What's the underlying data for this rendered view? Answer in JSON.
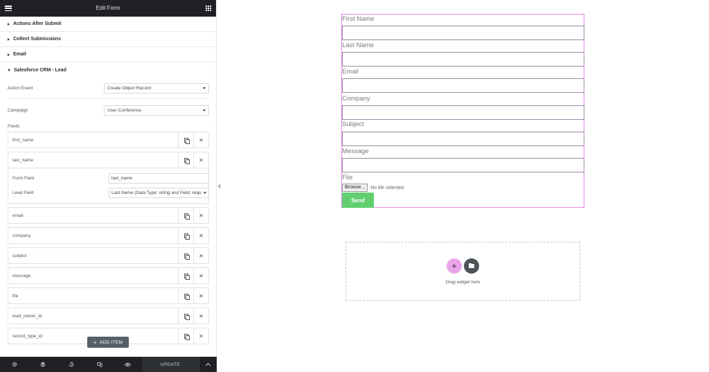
{
  "panel": {
    "title": "Edit Form",
    "sections": [
      {
        "label": "Actions After Submit"
      },
      {
        "label": "Collect Submissions"
      },
      {
        "label": "Email"
      },
      {
        "label": "Salesforce CRM - Lead"
      }
    ],
    "action_event": {
      "label": "Action Event",
      "value": "Create Object Record"
    },
    "campaign": {
      "label": "Campaign",
      "value": "User Conference"
    },
    "fields_label": "Fields",
    "items": [
      {
        "title": "first_name"
      },
      {
        "title": "last_name"
      },
      {
        "title": "email"
      },
      {
        "title": "company"
      },
      {
        "title": "subject"
      },
      {
        "title": "message"
      },
      {
        "title": "file"
      },
      {
        "title": "lead_owner_id"
      },
      {
        "title": "record_type_id"
      }
    ],
    "expanded": {
      "form_field_label": "Form Field",
      "form_field_value": "last_name",
      "lead_field_label": "Lead Field",
      "lead_field_value": "Last Name (Data Type: string and Field: requ"
    },
    "add_item_label": "ADD ITEM",
    "footer": {
      "update_label": "UPDATE"
    }
  },
  "form": {
    "fields": [
      {
        "label": "First Name"
      },
      {
        "label": "Last Name"
      },
      {
        "label": "Email"
      },
      {
        "label": "Company"
      },
      {
        "label": "Subject"
      },
      {
        "label": "Message"
      }
    ],
    "file_label": "File",
    "browse_label": "Browse...",
    "no_file_text": "No file selected.",
    "send_label": "Send"
  },
  "dropzone": {
    "text": "Drag widget here"
  },
  "colors": {
    "accent": "#e685e6",
    "send": "#61ce70",
    "dark": "#1f2124",
    "add_item": "#556068"
  }
}
